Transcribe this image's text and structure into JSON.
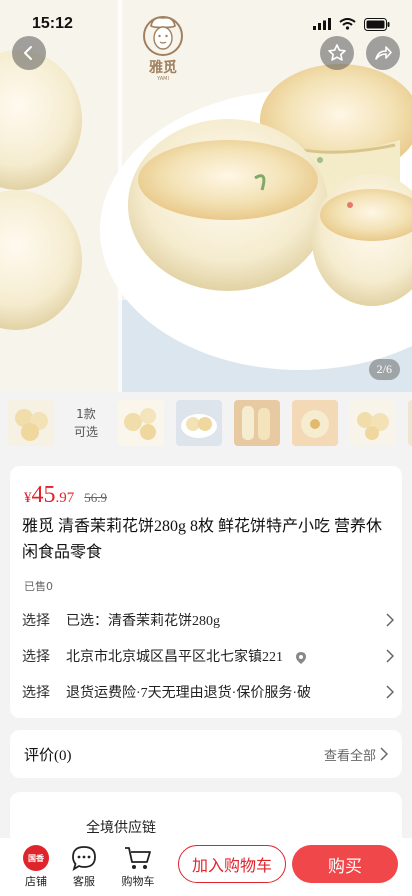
{
  "status_bar": {
    "time": "15:12"
  },
  "hero": {
    "brand_name": "雅觅",
    "brand_sub": "YAMI",
    "page_indicator": "2/6"
  },
  "thumbnails": {
    "count_line1": "1款",
    "count_line2": "可选"
  },
  "product": {
    "price_symbol": "¥",
    "price_integer": "45",
    "price_decimal": ".97",
    "original_price": "56.9",
    "title": "雅觅 清香茉莉花饼280g 8枚 鲜花饼特产小吃 营养休闲食品零食",
    "sold": "已售0"
  },
  "options": [
    {
      "key": "选择",
      "value": "已选：清香茉莉花饼280g"
    },
    {
      "key": "选择",
      "value": "北京市北京城区昌平区北七家镇221"
    },
    {
      "key": "选择",
      "value": "退货运费险·7天无理由退货·保价服务·破"
    }
  ],
  "reviews": {
    "title": "评价(0)",
    "more": "查看全部"
  },
  "supply": {
    "title": "全境供应链"
  },
  "bottom_bar": {
    "store_badge": "国香",
    "store_label": "店铺",
    "service_label": "客服",
    "cart_label": "购物车",
    "add_to_cart": "加入购物车",
    "buy_now": "购买"
  },
  "colors": {
    "accent": "#e0242c",
    "buy_button": "#f0474a"
  }
}
